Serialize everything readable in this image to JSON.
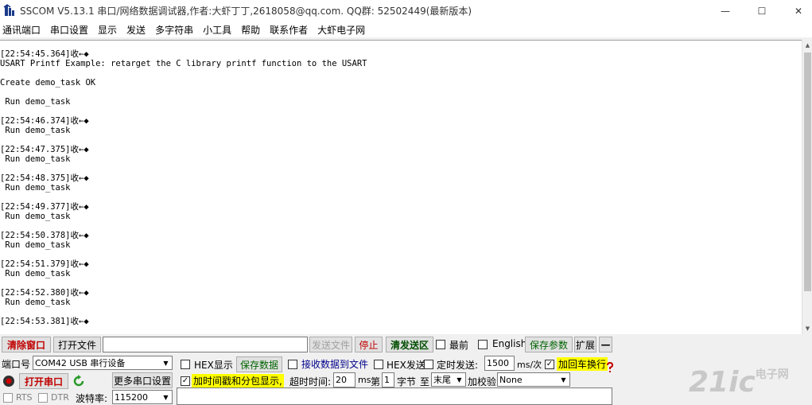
{
  "window": {
    "title": "SSCOM V5.13.1 串口/网络数据调试器,作者:大虾丁丁,2618058@qq.com. QQ群: 52502449(最新版本)",
    "min_glyph": "—",
    "max_glyph": "☐",
    "close_glyph": "✕"
  },
  "menu": [
    "通讯端口",
    "串口设置",
    "显示",
    "发送",
    "多字符串",
    "小工具",
    "帮助",
    "联系作者",
    "大虾电子网"
  ],
  "receive": {
    "lines": "[22:54:45.364]收←◆\nUSART Printf Example: retarget the C library printf function to the USART\n\nCreate demo_task OK\n\n Run demo_task\n\n[22:54:46.374]收←◆\n Run demo_task\n\n[22:54:47.375]收←◆\n Run demo_task\n\n[22:54:48.375]收←◆\n Run demo_task\n\n[22:54:49.377]收←◆\n Run demo_task\n\n[22:54:50.378]收←◆\n Run demo_task\n\n[22:54:51.379]收←◆\n Run demo_task\n\n[22:54:52.380]收←◆\n Run demo_task\n\n[22:54:53.381]收←◆"
  },
  "toolbar": {
    "clear_window": "清除窗口",
    "open_file": "打开文件",
    "file_path": "",
    "send_file": "发送文件",
    "stop": "停止",
    "clear_send": "清发送区",
    "topmost": "最前",
    "english": "English",
    "save_params": "保存参数",
    "expand": "扩展",
    "collapse": "—"
  },
  "port": {
    "port_label": "端口号",
    "port_value": "COM42  USB 串行设备",
    "open_port": "打开串口",
    "more_settings": "更多串口设置",
    "rts": "RTS",
    "dtr": "DTR",
    "baud_label": "波特率:",
    "baud_value": "115200"
  },
  "options": {
    "hex_display": "HEX显示",
    "save_data": "保存数据",
    "recv_to_file": "接收数据到文件",
    "hex_send": "HEX发送",
    "timed_send": "定时发送:",
    "interval": "1500",
    "interval_unit": "ms/次",
    "add_crlf": "加回车换行",
    "timestamp": "加时间戳和分包显示,",
    "timeout_label": "超时时间:",
    "timeout": "20",
    "timeout_unit": "ms",
    "byte_prefix": "第",
    "byte_index": "1",
    "byte_suffix": "字节",
    "to_label": "至",
    "to_value": "末尾",
    "checksum_label": "加校验",
    "checksum_value": "None",
    "check_mark": "✓"
  },
  "watermark": {
    "text": "21ic",
    "sub": "电子网"
  },
  "colors": {
    "accent_red": "#c00000",
    "highlight": "#ffff00",
    "save_green": "#006400"
  }
}
